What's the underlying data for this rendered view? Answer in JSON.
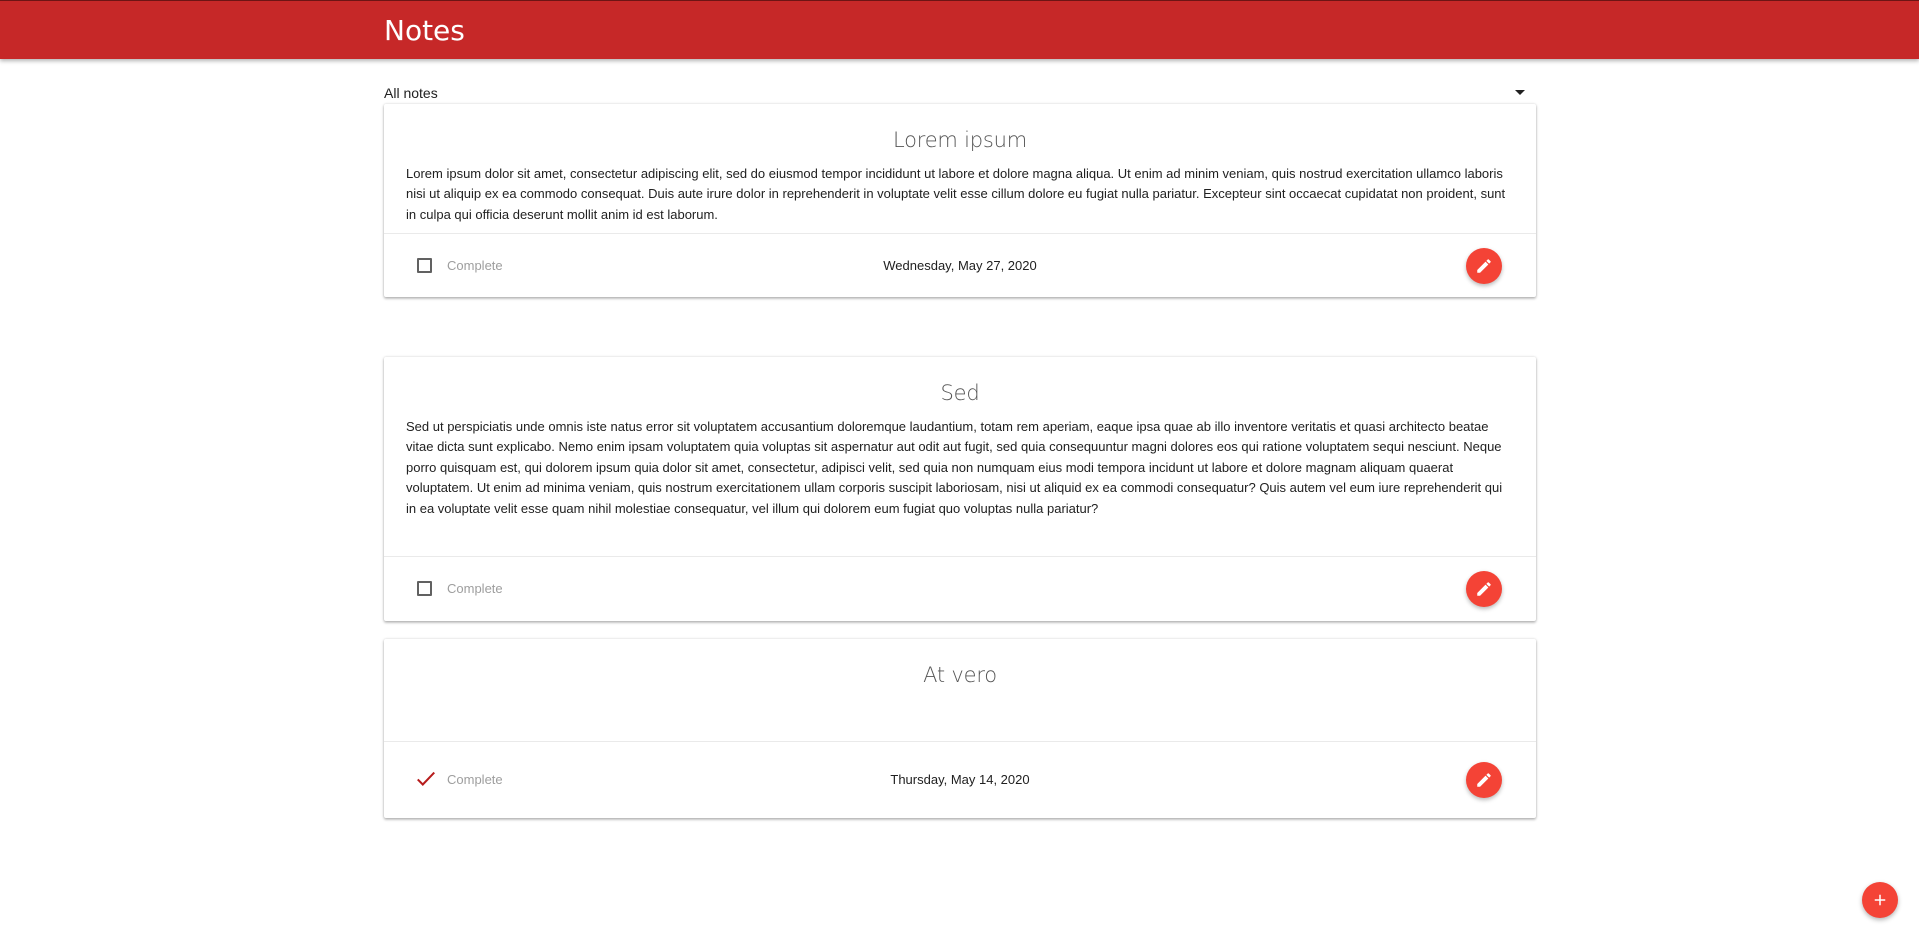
{
  "app": {
    "title": "Notes",
    "bar_color": "#c62828",
    "accent_color": "#f44336"
  },
  "filter": {
    "selected": "All notes"
  },
  "notes": [
    {
      "title": "Lorem ipsum",
      "body": "Lorem ipsum dolor sit amet, consectetur adipiscing elit, sed do eiusmod tempor incididunt ut labore et dolore magna aliqua. Ut enim ad minim veniam, quis nostrud exercitation ullamco laboris nisi ut aliquip ex ea commodo consequat. Duis aute irure dolor in reprehenderit in voluptate velit esse cillum dolore eu fugiat nulla pariatur. Excepteur sint occaecat cupidatat non proident, sunt in culpa qui officia deserunt mollit anim id est laborum.",
      "complete": false,
      "complete_label": "Complete",
      "date": "Wednesday, May 27, 2020",
      "edit_icon": "pencil-icon"
    },
    {
      "title": "Sed",
      "body": "Sed ut perspiciatis unde omnis iste natus error sit voluptatem accusantium doloremque laudantium, totam rem aperiam, eaque ipsa quae ab illo inventore veritatis et quasi architecto beatae vitae dicta sunt explicabo. Nemo enim ipsam voluptatem quia voluptas sit aspernatur aut odit aut fugit, sed quia consequuntur magni dolores eos qui ratione voluptatem sequi nesciunt. Neque porro quisquam est, qui dolorem ipsum quia dolor sit amet, consectetur, adipisci velit, sed quia non numquam eius modi tempora incidunt ut labore et dolore magnam aliquam quaerat voluptatem. Ut enim ad minima veniam, quis nostrum exercitationem ullam corporis suscipit laboriosam, nisi ut aliquid ex ea commodi consequatur? Quis autem vel eum iure reprehenderit qui in ea voluptate velit esse quam nihil molestiae consequatur, vel illum qui dolorem eum fugiat quo voluptas nulla pariatur?",
      "complete": false,
      "complete_label": "Complete",
      "date": "",
      "edit_icon": "pencil-icon"
    },
    {
      "title": "At vero",
      "body": "",
      "complete": true,
      "complete_label": "Complete",
      "date": "Thursday, May 14, 2020",
      "edit_icon": "pencil-icon",
      "check_color": "#b71c1c"
    }
  ],
  "add_button": {
    "icon": "plus-icon"
  }
}
